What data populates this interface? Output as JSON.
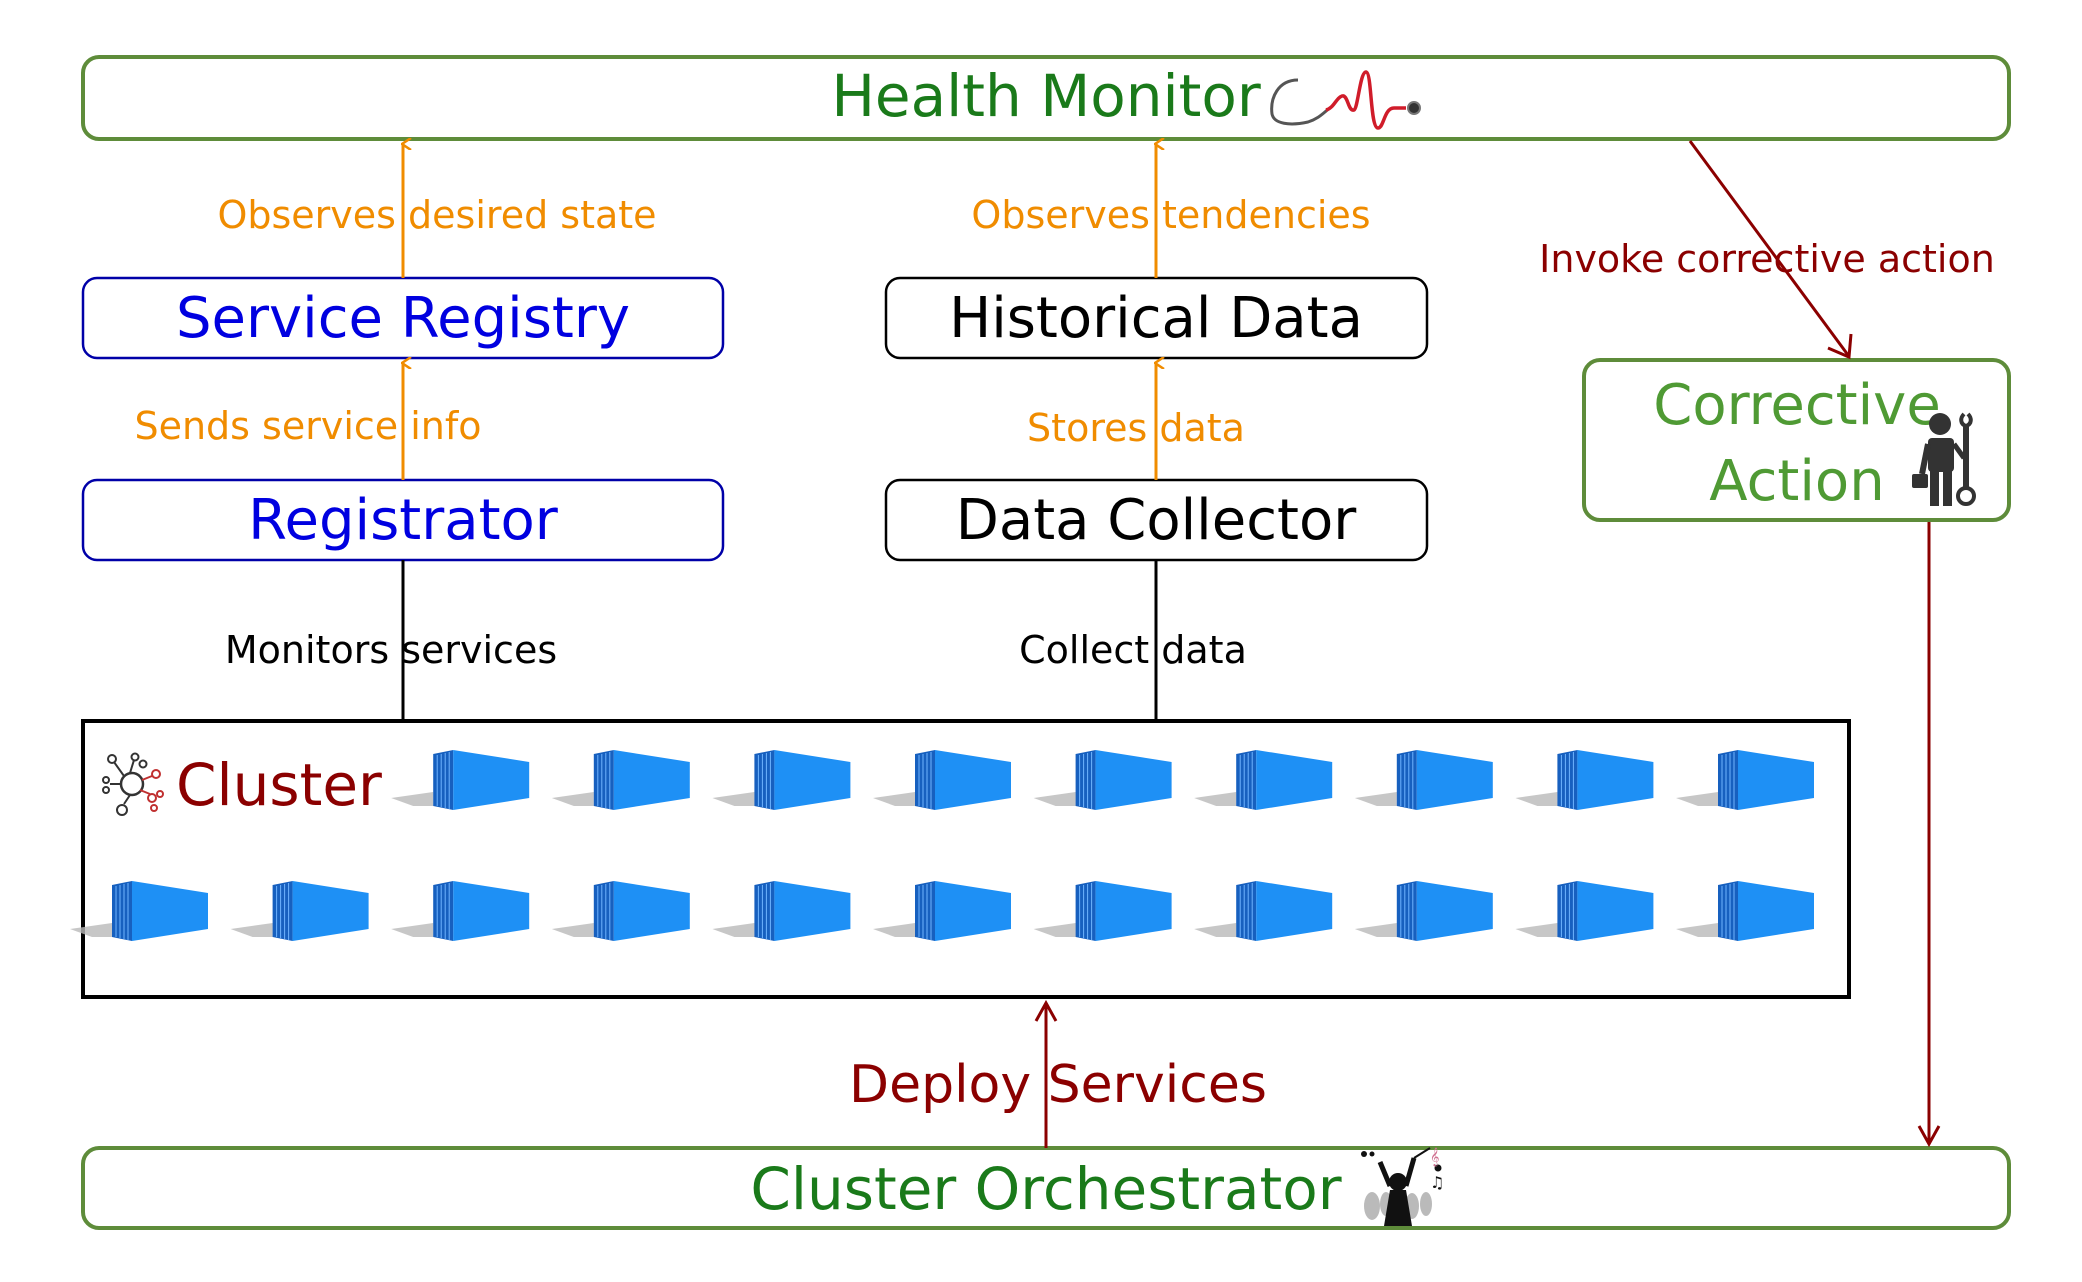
{
  "colors": {
    "green_border": "#5e8c3a",
    "green_text": "#1a7a1a",
    "light_green_text": "#4f9a34",
    "blue_text": "#0000e0",
    "blue_border": "#0000a8",
    "black": "#000000",
    "orange": "#f08c00",
    "dark_red": "#8b0000",
    "container_blue": "#1e8ff0",
    "container_dark": "#1560b8"
  },
  "nodes": {
    "health_monitor": {
      "label": "Health Monitor",
      "icon": "stethoscope-heartbeat-icon"
    },
    "service_registry": {
      "label": "Service Registry"
    },
    "historical_data": {
      "label": "Historical Data"
    },
    "registrator": {
      "label": "Registrator"
    },
    "data_collector": {
      "label": "Data Collector"
    },
    "corrective_action": {
      "label_line1": "Corrective",
      "label_line2": "Action",
      "icon": "repairman-wrench-icon"
    },
    "cluster": {
      "label": "Cluster",
      "icon": "network-hub-icon",
      "container_count_row1": 9,
      "container_count_row2": 11
    },
    "cluster_orchestrator": {
      "label": "Cluster Orchestrator",
      "icon": "orchestra-conductor-icon"
    }
  },
  "edges": {
    "observes_desired_state": "Observes desired state",
    "observes_tendencies": "Observes tendencies",
    "sends_service_info": "Sends service info",
    "stores_data": "Stores data",
    "monitors_services": "Monitors services",
    "collect_data": "Collect data",
    "invoke_corrective_action": "Invoke corrective action",
    "deploy_services": "Deploy Services"
  }
}
